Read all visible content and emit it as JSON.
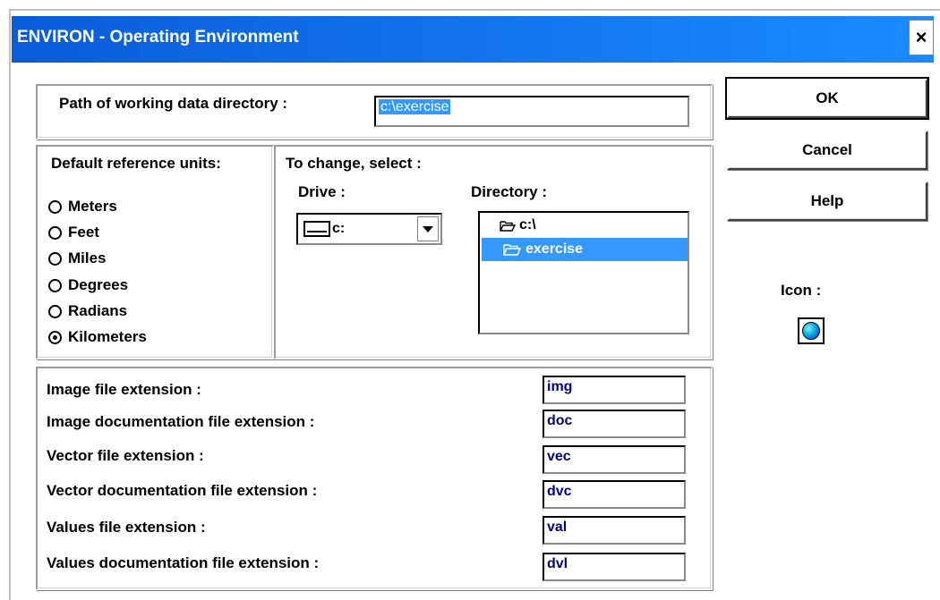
{
  "window": {
    "title": "ENVIRON - Operating Environment",
    "close_label": "×"
  },
  "path": {
    "label": "Path of working data directory :",
    "value": "c:\\exercise"
  },
  "units": {
    "label": "Default reference units:",
    "options": [
      "Meters",
      "Feet",
      "Miles",
      "Degrees",
      "Radians",
      "Kilometers"
    ],
    "selected": "Kilometers"
  },
  "change": {
    "label": "To change, select :",
    "drive_label": "Drive :",
    "drive_value": "c:",
    "directory_label": "Directory :",
    "directories": [
      {
        "name": "c:\\",
        "icon": "open-folder-icon",
        "selected": false
      },
      {
        "name": "exercise",
        "icon": "open-folder-icon",
        "selected": true
      }
    ]
  },
  "extensions": [
    {
      "label": "Image file extension :",
      "value": "img"
    },
    {
      "label": "Image documentation file extension :",
      "value": "doc"
    },
    {
      "label": "Vector file extension :",
      "value": "vec"
    },
    {
      "label": "Vector documentation file extension :",
      "value": "dvc"
    },
    {
      "label": "Values file extension :",
      "value": "val"
    },
    {
      "label": "Values documentation file extension :",
      "value": "dvl"
    }
  ],
  "buttons": {
    "ok": "OK",
    "cancel": "Cancel",
    "help": "Help"
  },
  "icon": {
    "label": "Icon :",
    "name": "globe-icon"
  },
  "colors": {
    "title_bar": "#0a5cd8",
    "selection": "#3399ff",
    "field_text": "#000080"
  }
}
